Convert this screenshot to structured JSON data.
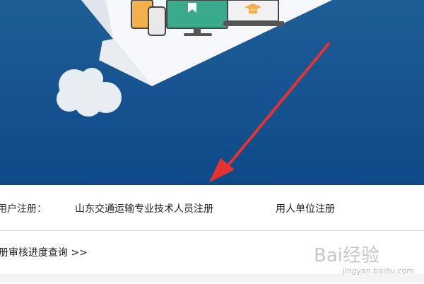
{
  "registration": {
    "label": "用户注册：",
    "links": [
      {
        "text": "山东交通运输专业技术人员注册"
      },
      {
        "text": "用人单位注册"
      }
    ]
  },
  "query": {
    "text": "册审核进度查询 >>"
  },
  "watermark": {
    "brand": "Bai经验",
    "url": "jingyan.baidu.com"
  },
  "colors": {
    "banner": "#165290",
    "arrow": "#e8322f"
  }
}
